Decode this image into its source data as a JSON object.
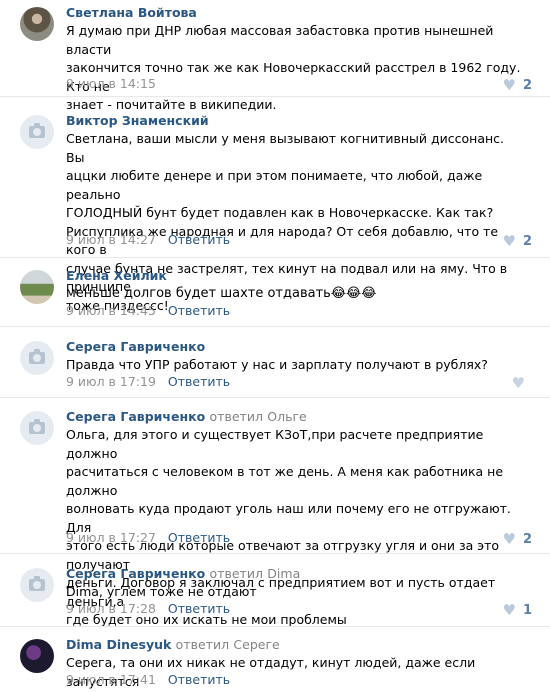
{
  "comments": [
    {
      "author": "Светлана Войтова",
      "reply_to_label": "",
      "reply_to_name": "",
      "avatar": "photo-woman",
      "text": "Я думаю при ДНР любая массовая забастовка против нынешней власти\nзакончится точно так же как Новочеркасский расстрел в 1962 году. Кто не\nзнает - почитайте в википедии.",
      "time": "9 июл в 14:15",
      "reply_label": "",
      "likes": "2"
    },
    {
      "author": "Виктор Знаменский",
      "reply_to_label": "",
      "reply_to_name": "",
      "avatar": "camera-placeholder",
      "text": "Светлана, ваши мысли у меня вызывают когнитивный диссонанс. Вы\nаццки любите денере и при этом понимаете, что любой, даже реально\nГОЛОДНЫЙ бунт будет подавлен как в Новочеркасске. Как так?\nРиспуплика же народная и для народа? От себя добавлю, что те кого в\nслучае бунта не застрелят, тех кинут на подвал или на яму. Что в принципе\nтоже пиздессс!",
      "time": "9 июл в 14:27",
      "reply_label": "Ответить",
      "likes": "2"
    },
    {
      "author": "Елена Хейлик",
      "reply_to_label": "",
      "reply_to_name": "",
      "avatar": "photo-outdoor",
      "text": "меньше долгов будет шахте отдавать😂😂😂",
      "time": "9 июл в 14:45",
      "reply_label": "Ответить",
      "likes": ""
    },
    {
      "author": "Серега Гавриченко",
      "reply_to_label": "",
      "reply_to_name": "",
      "avatar": "camera-placeholder",
      "text": "Правда что УПР работают у нас и зарплату получают в рублях?",
      "time": "9 июл в 17:19",
      "reply_label": "Ответить",
      "likes": ""
    },
    {
      "author": "Серега Гавриченко",
      "reply_to_label": "ответил",
      "reply_to_name": "Ольге",
      "avatar": "camera-placeholder",
      "text": "Ольга, для этого и существует КЗоТ,при расчете предприятие должно\nрасчитаться с человеком в тот же день. А меня как работника не должно\nволновать куда продают уголь наш или почему его не отгружают. Для\nэтого есть люди которые отвечают за отгрузку угля и они за это получают\nденьги. Договор я заключал с предприятием вот и пусть отдает деньги,а\nгде будет оно их искать не мои проблемы",
      "time": "9 июл в 17:27",
      "reply_label": "Ответить",
      "likes": "2"
    },
    {
      "author": "Серега Гавриченко",
      "reply_to_label": "ответил",
      "reply_to_name": "Dima",
      "avatar": "camera-placeholder",
      "text": "Dima, углем тоже не отдают",
      "time": "9 июл в 17:28",
      "reply_label": "Ответить",
      "likes": "1"
    },
    {
      "author": "Dima Dinesyuk",
      "reply_to_label": "ответил",
      "reply_to_name": "Сереге",
      "avatar": "photo-dark",
      "text": "Серега, та они их никак не отдадут, кинут людей, даже если запустятся",
      "time": "9 июл в 17:41",
      "reply_label": "Ответить",
      "likes": ""
    }
  ],
  "colors": {
    "author_link": "#2a5885",
    "meta_gray": "#939393",
    "like_blue": "#5b7fa6",
    "divider": "#e7e8ec"
  }
}
